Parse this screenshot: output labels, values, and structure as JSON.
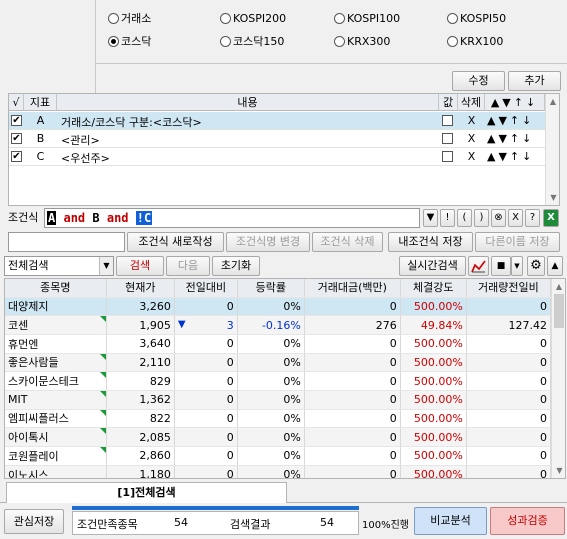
{
  "markets": {
    "row1": [
      {
        "label": "거래소",
        "on": false
      },
      {
        "label": "KOSPI200",
        "on": false
      },
      {
        "label": "KOSPI100",
        "on": false
      },
      {
        "label": "KOSPI50",
        "on": false
      }
    ],
    "row2": [
      {
        "label": "코스닥",
        "on": true
      },
      {
        "label": "코스닥150",
        "on": false
      },
      {
        "label": "KRX300",
        "on": false
      },
      {
        "label": "KRX100",
        "on": false
      }
    ]
  },
  "top_buttons": {
    "edit": "수정",
    "add": "추가"
  },
  "cond_table": {
    "headers": {
      "check": "√",
      "index": "지표",
      "content": "내용",
      "value": "값",
      "delete": "삭제"
    },
    "rows": [
      {
        "index": "A",
        "content": "거래소/코스닥 구분:<코스닥>",
        "del": "X"
      },
      {
        "index": "B",
        "content": "<관리>",
        "del": "X"
      },
      {
        "index": "C",
        "content": "<우선주>",
        "del": "X"
      }
    ]
  },
  "formula": {
    "label": "조건식",
    "a": "A",
    "and1": "and",
    "b": "B",
    "and2": "and",
    "c": "!C"
  },
  "formula_tools": [
    "▼",
    "!",
    "(",
    ")",
    "⊗",
    "X",
    "?"
  ],
  "actions": {
    "new": "조건식 새로작성",
    "rename": "조건식명 변경",
    "delete": "조건식 삭제",
    "save": "내조건식 저장",
    "save_as": "다른이름 저장"
  },
  "search_bar": {
    "scope": "전체검색",
    "search": "검색",
    "next": "다음",
    "reset": "초기화",
    "realtime": "실시간검색"
  },
  "results": {
    "headers": [
      "종목명",
      "현재가",
      "전일대비",
      "등락률",
      "거래대금(백만)",
      "체결강도",
      "거래량전일비"
    ],
    "rows": [
      {
        "name": "대양제지",
        "price": "3,260",
        "change": "0",
        "arrow": "",
        "rate": "0%",
        "amount": "0",
        "strength": "500.00%",
        "vol": "0",
        "flag": false
      },
      {
        "name": "코센",
        "price": "1,905",
        "change": "3",
        "arrow": "▼",
        "rate": "-0.16%",
        "amount": "276",
        "strength": "49.84%",
        "vol": "127.42",
        "flag": true
      },
      {
        "name": "휴먼엔",
        "price": "3,640",
        "change": "0",
        "arrow": "",
        "rate": "0%",
        "amount": "0",
        "strength": "500.00%",
        "vol": "0",
        "flag": false
      },
      {
        "name": "좋은사람들",
        "price": "2,110",
        "change": "0",
        "arrow": "",
        "rate": "0%",
        "amount": "0",
        "strength": "500.00%",
        "vol": "0",
        "flag": true
      },
      {
        "name": "스카이문스테크",
        "price": "829",
        "change": "0",
        "arrow": "",
        "rate": "0%",
        "amount": "0",
        "strength": "500.00%",
        "vol": "0",
        "flag": true
      },
      {
        "name": "MIT",
        "price": "1,362",
        "change": "0",
        "arrow": "",
        "rate": "0%",
        "amount": "0",
        "strength": "500.00%",
        "vol": "0",
        "flag": true
      },
      {
        "name": "엠피씨플러스",
        "price": "822",
        "change": "0",
        "arrow": "",
        "rate": "0%",
        "amount": "0",
        "strength": "500.00%",
        "vol": "0",
        "flag": true
      },
      {
        "name": "아이톡시",
        "price": "2,085",
        "change": "0",
        "arrow": "",
        "rate": "0%",
        "amount": "0",
        "strength": "500.00%",
        "vol": "0",
        "flag": true
      },
      {
        "name": "코원플레이",
        "price": "2,860",
        "change": "0",
        "arrow": "",
        "rate": "0%",
        "amount": "0",
        "strength": "500.00%",
        "vol": "0",
        "flag": true
      },
      {
        "name": "이노시스",
        "price": "1,180",
        "change": "0",
        "arrow": "",
        "rate": "0%",
        "amount": "0",
        "strength": "500.00%",
        "vol": "0",
        "flag": false
      }
    ]
  },
  "tab": {
    "label": "[1]전체검색"
  },
  "footer": {
    "save_interest": "관심저장",
    "match_label": "조건만족종목",
    "match_value": "54",
    "result_label": "검색결과",
    "result_value": "54",
    "progress_text": "100%진행",
    "progress_fraction": 1.0,
    "compare": "비교분석",
    "verify": "성과검증"
  },
  "colors": {
    "search_btn": "#f7d4d4",
    "compare_btn": "#cfe2f7",
    "verify_btn": "#f8c9c9",
    "progress": "#1f6fd0",
    "strength_red": "#d00000",
    "green_flag": "#1a9a3a"
  }
}
